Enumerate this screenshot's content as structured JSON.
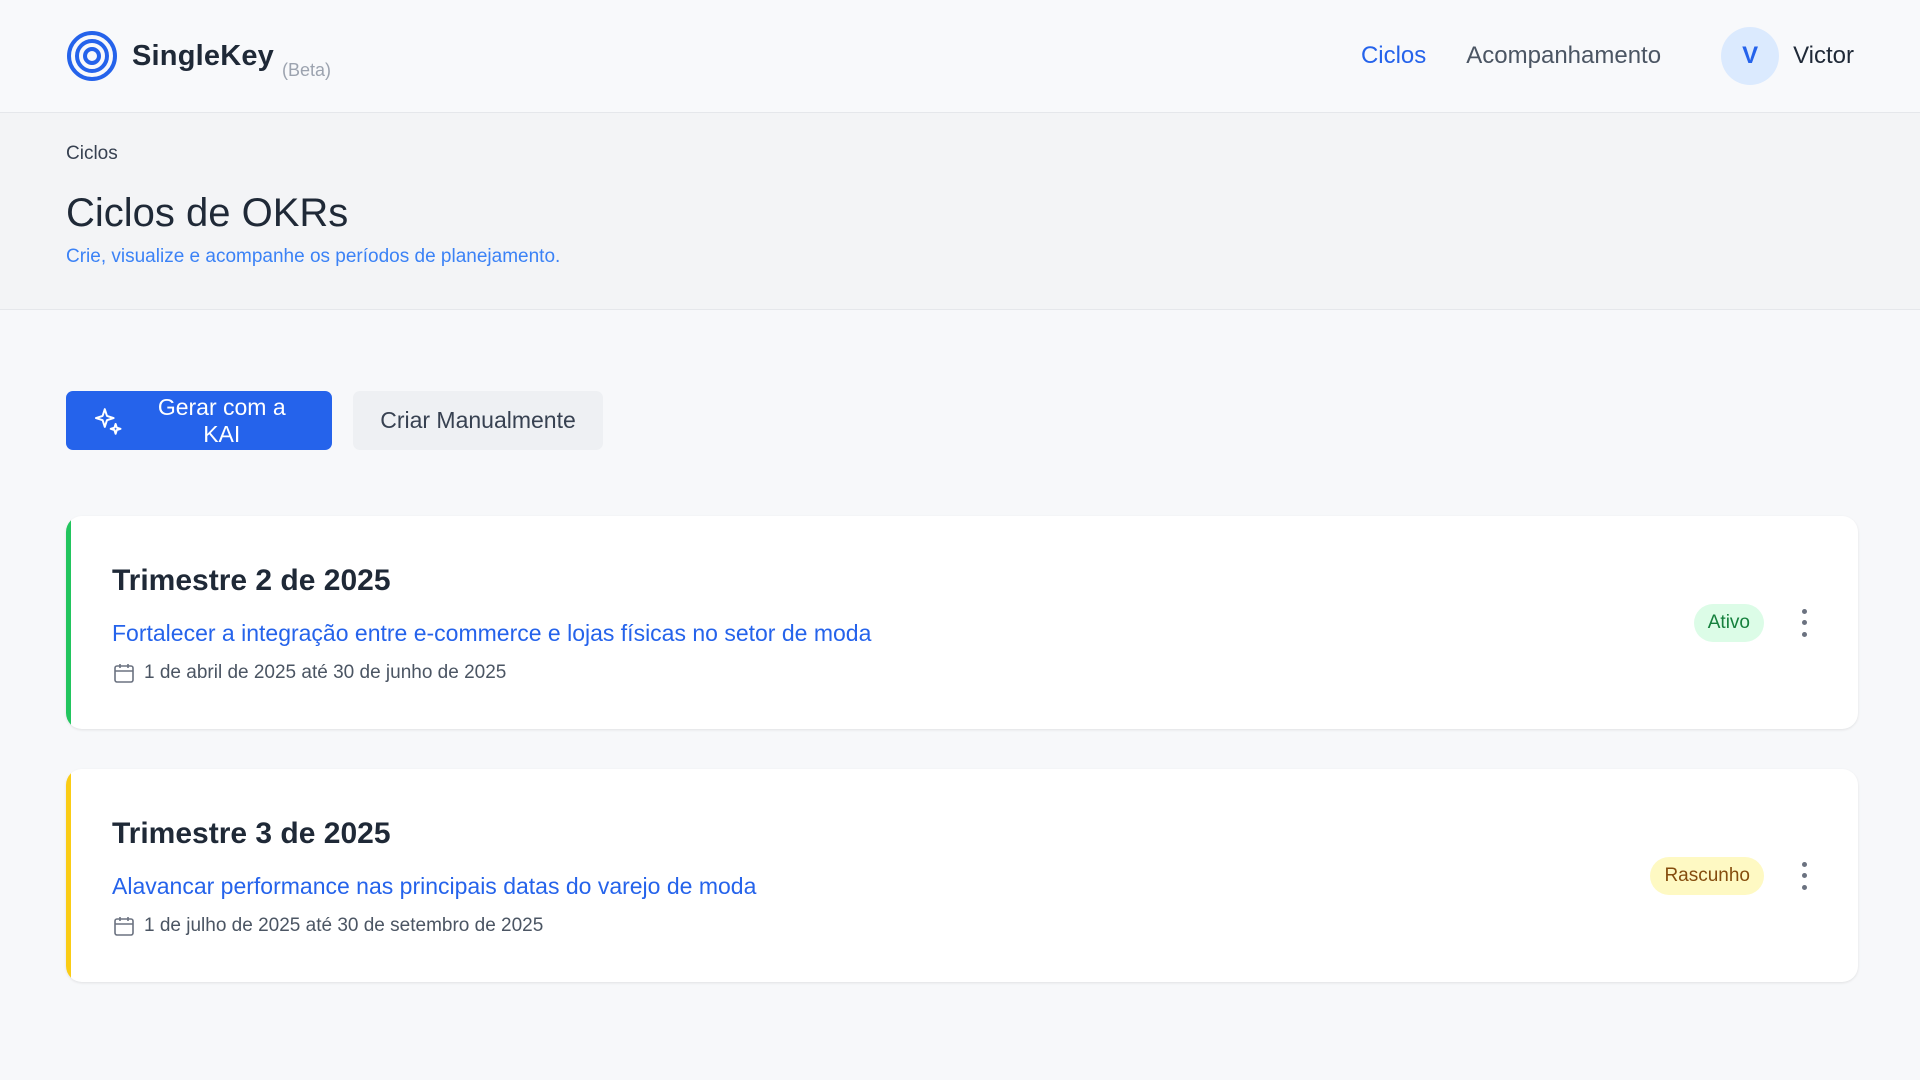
{
  "brand": {
    "name": "SingleKey",
    "beta": "(Beta)",
    "logo_icon": "target-icon",
    "color": "#2563eb"
  },
  "nav": {
    "items": [
      {
        "label": "Ciclos",
        "active": true
      },
      {
        "label": "Acompanhamento",
        "active": false
      }
    ]
  },
  "user": {
    "initial": "V",
    "name": "Victor"
  },
  "header": {
    "breadcrumb": "Ciclos",
    "title": "Ciclos de OKRs",
    "subtitle": "Crie, visualize e acompanhe os períodos de planejamento."
  },
  "actions": {
    "generate_label": "Gerar com a KAI",
    "generate_icon": "sparkles-icon",
    "manual_label": "Criar Manualmente"
  },
  "cycles": [
    {
      "title": "Trimestre 2 de 2025",
      "objective": "Fortalecer a integração entre e-commerce e lojas físicas no setor de moda",
      "dates": "1 de abril de 2025 até 30 de junho de 2025",
      "status": "Ativo",
      "accent_color": "#22c55e",
      "badge_bg": "#dcfce7",
      "badge_color": "#15803d"
    },
    {
      "title": "Trimestre 3 de 2025",
      "objective": "Alavancar performance nas principais datas do varejo de moda",
      "dates": "1 de julho de 2025 até 30 de setembro de 2025",
      "status": "Rascunho",
      "accent_color": "#facc15",
      "badge_bg": "#fef9c3",
      "badge_color": "#854d0e"
    }
  ]
}
